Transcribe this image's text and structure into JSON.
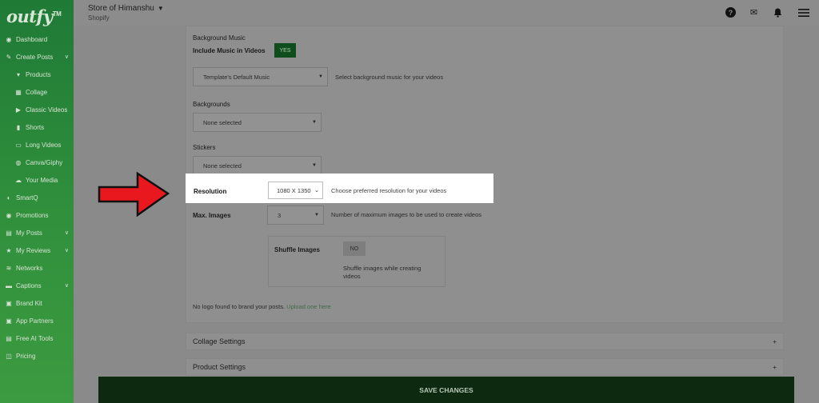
{
  "brand": {
    "logo_text": "outfy",
    "logo_tm": "TM"
  },
  "header": {
    "store_name": "Store of Himanshu",
    "platform": "Shopify"
  },
  "sidebar": {
    "items": [
      {
        "label": "Dashboard",
        "icon": "dashboard-icon",
        "glyph": "◉"
      },
      {
        "label": "Create Posts",
        "icon": "pencil-icon",
        "glyph": "✎",
        "chevron": "∨"
      },
      {
        "label": "Products",
        "icon": "shirt-icon",
        "glyph": "▾"
      },
      {
        "label": "Collage",
        "icon": "grid-icon",
        "glyph": "▦"
      },
      {
        "label": "Classic Videos",
        "icon": "play-icon",
        "glyph": "▶"
      },
      {
        "label": "Shorts",
        "icon": "shorts-icon",
        "glyph": "▮"
      },
      {
        "label": "Long Videos",
        "icon": "video-icon",
        "glyph": "▭"
      },
      {
        "label": "Canva/Giphy",
        "icon": "palette-icon",
        "glyph": "◍"
      },
      {
        "label": "Your Media",
        "icon": "cloud-icon",
        "glyph": "☁"
      },
      {
        "label": "SmartQ",
        "icon": "smartq-icon",
        "glyph": "◐"
      },
      {
        "label": "Promotions",
        "icon": "promotions-icon",
        "glyph": "◉"
      },
      {
        "label": "My Posts",
        "icon": "posts-icon",
        "glyph": "▤",
        "chevron": "∨"
      },
      {
        "label": "My Reviews",
        "icon": "star-icon",
        "glyph": "★",
        "chevron": "∨"
      },
      {
        "label": "Networks",
        "icon": "wifi-icon",
        "glyph": "≋"
      },
      {
        "label": "Captions",
        "icon": "captions-icon",
        "glyph": "▬",
        "chevron": "∨"
      },
      {
        "label": "Brand Kit",
        "icon": "brandkit-icon",
        "glyph": "▣"
      },
      {
        "label": "App Partners",
        "icon": "partners-icon",
        "glyph": "▣"
      },
      {
        "label": "Free AI Tools",
        "icon": "ai-tools-icon",
        "glyph": "▤"
      },
      {
        "label": "Pricing",
        "icon": "pricing-icon",
        "glyph": "◫"
      }
    ]
  },
  "settings": {
    "background_music_title": "Background Music",
    "include_music_label": "Include Music in Videos",
    "include_music_value": "YES",
    "music_select_value": "Template's Default Music",
    "music_hint": "Select background music for your videos",
    "backgrounds_label": "Backgrounds",
    "backgrounds_value": "None selected",
    "stickers_label": "Stickers",
    "stickers_value": "None selected",
    "resolution_label": "Resolution",
    "resolution_value": "1080 X 1350",
    "resolution_hint": "Choose preferred resolution for your videos",
    "max_images_label": "Max. Images",
    "max_images_value": "3",
    "max_images_hint": "Number of maximum images to be used to create videos",
    "shuffle_label": "Shuffle Images",
    "shuffle_value": "NO",
    "shuffle_hint_line1": "Shuffle images while creating",
    "shuffle_hint_line2": "videos",
    "logo_notice": "No logo found to brand your posts.",
    "logo_link": "Upload one here"
  },
  "accordions": [
    {
      "label": "Collage Settings",
      "symbol": "+"
    },
    {
      "label": "Product Settings",
      "symbol": "+"
    }
  ],
  "footer": {
    "save_label": "SAVE CHANGES"
  },
  "colors": {
    "accent_green": "#0f4d1c",
    "highlight": "#ffffff",
    "arrow_red": "#e8181e"
  }
}
